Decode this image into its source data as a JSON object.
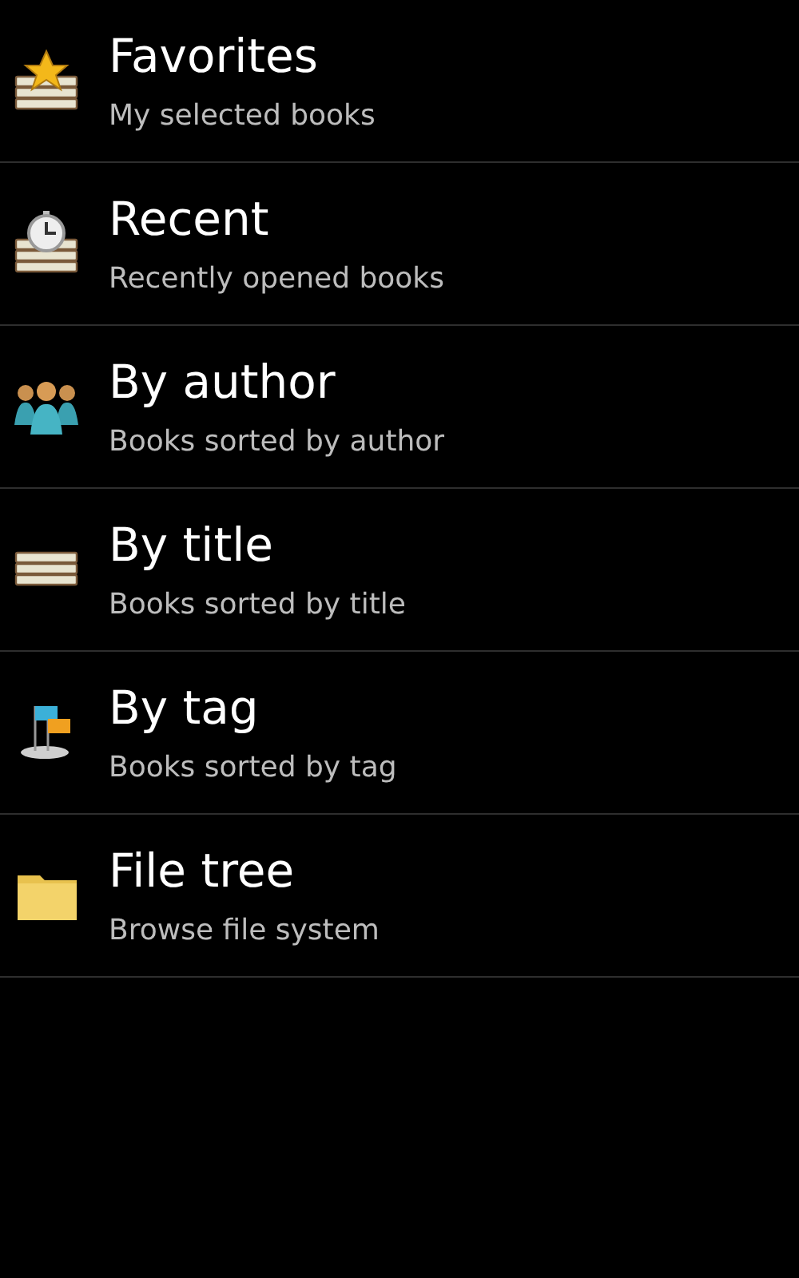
{
  "items": [
    {
      "kind": "favorites",
      "title": "Favorites",
      "subtitle": "My selected books"
    },
    {
      "kind": "recent",
      "title": "Recent",
      "subtitle": "Recently opened books"
    },
    {
      "kind": "author",
      "title": "By author",
      "subtitle": "Books sorted by author"
    },
    {
      "kind": "title",
      "title": "By title",
      "subtitle": "Books sorted by title"
    },
    {
      "kind": "tag",
      "title": "By tag",
      "subtitle": "Books sorted by tag"
    },
    {
      "kind": "folder",
      "title": "File tree",
      "subtitle": "Browse file system"
    }
  ]
}
